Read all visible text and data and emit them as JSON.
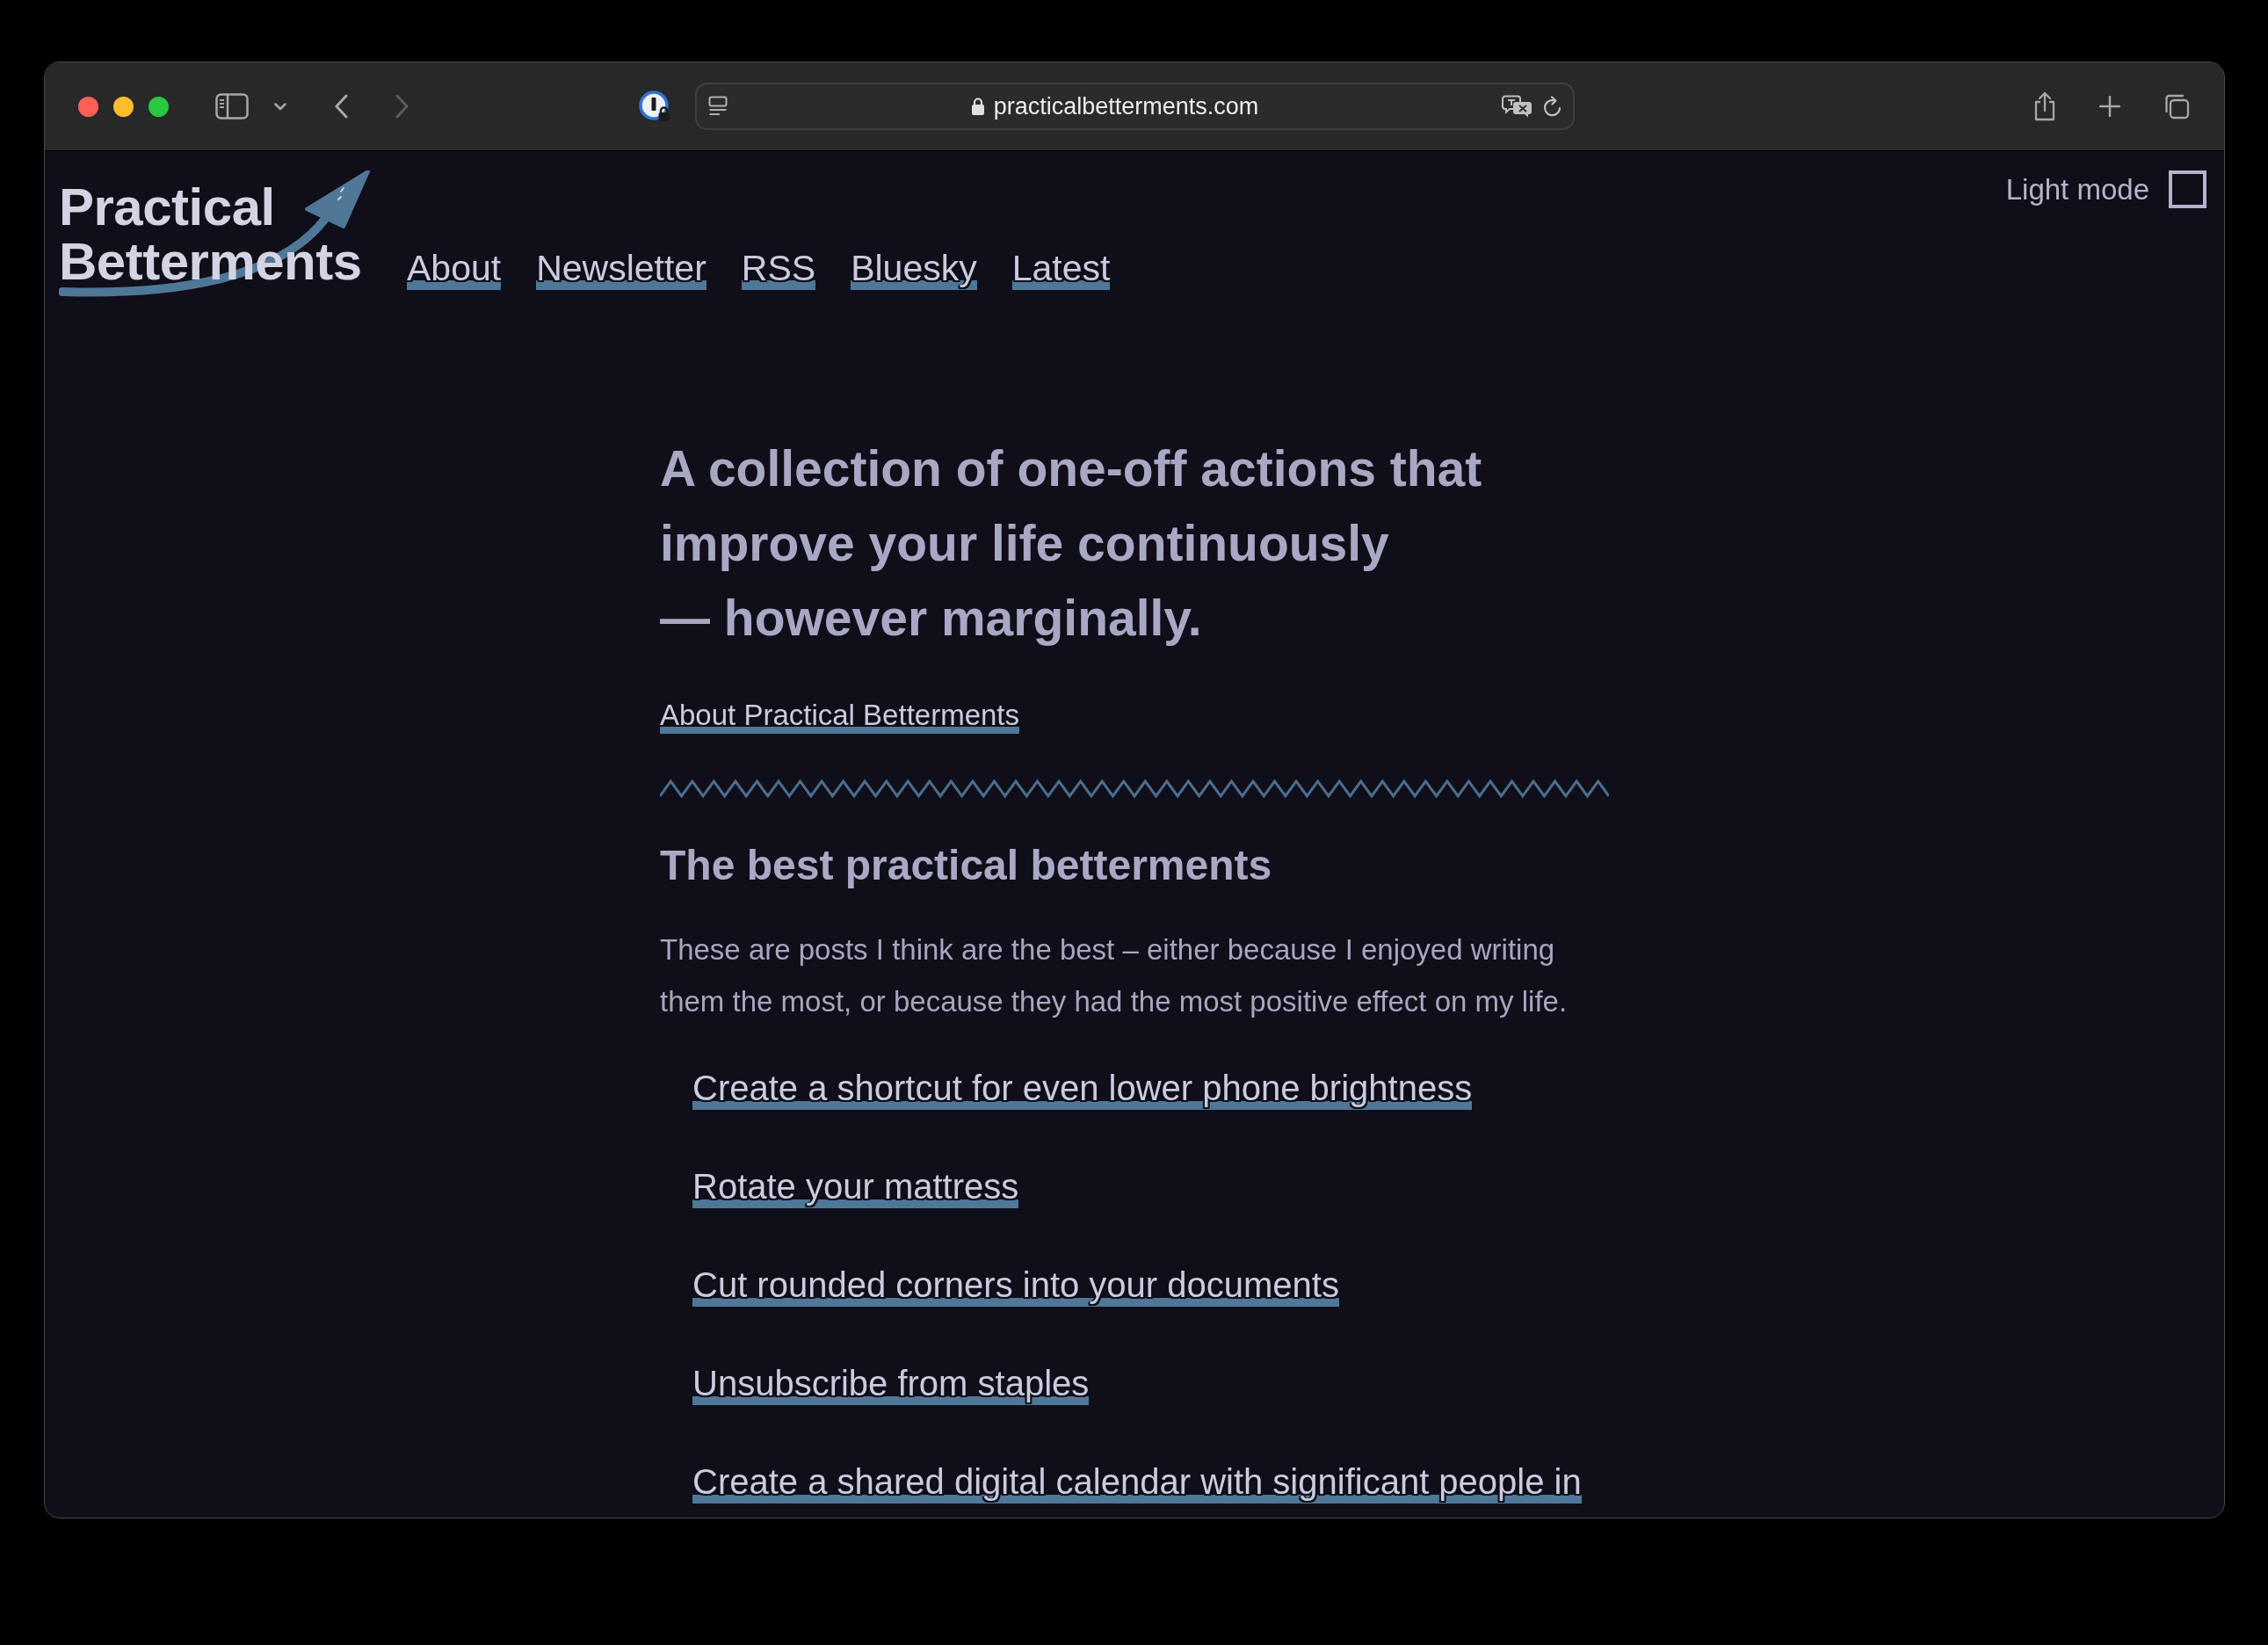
{
  "browser": {
    "nav_buttons": [
      {
        "kind": "back",
        "disabled": false
      },
      {
        "kind": "forward",
        "disabled": true
      }
    ],
    "url": "practicalbetterments.com"
  },
  "header": {
    "logo": "Practical Betterments",
    "nav": [
      "About",
      "Newsletter",
      "RSS",
      "Bluesky",
      "Latest"
    ],
    "light_mode": {
      "label": "Light mode",
      "checked": false
    }
  },
  "intro": {
    "heading": "A collection of one-off actions that\nimprove your life continuously\n— however marginally.",
    "link": "About Practical Betterments"
  },
  "best": {
    "title": "The best practical betterments",
    "description": "These are posts I think are the best – either because I enjoyed writing them the most, or because they had the most positive effect on my life.",
    "posts": [
      "Create a shortcut for even lower phone brightness",
      "Rotate your mattress",
      "Cut rounded corners into your documents",
      "Unsubscribe from staples",
      "Create a shared digital calendar with significant people in"
    ]
  }
}
